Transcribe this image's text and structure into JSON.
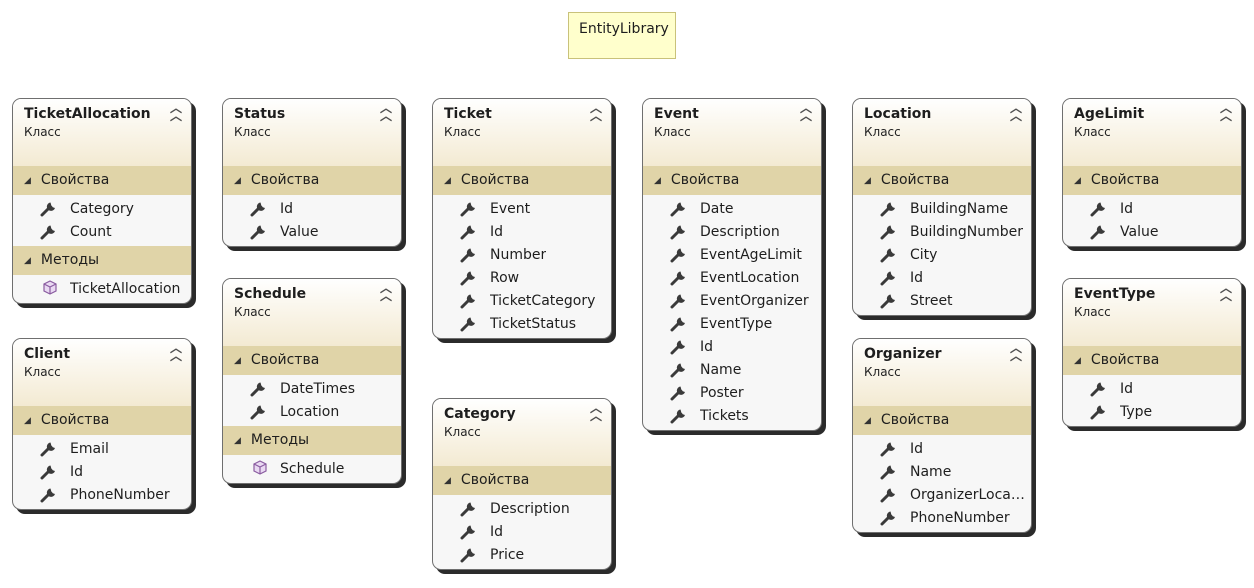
{
  "note": {
    "text": "EntityLibrary"
  },
  "kind_label": "Класс",
  "props_label": "Свойства",
  "methods_label": "Методы",
  "classes": {
    "ticketallocation": {
      "name": "TicketAllocation",
      "properties": [
        "Category",
        "Count"
      ],
      "methods": [
        "TicketAllocation"
      ]
    },
    "client": {
      "name": "Client",
      "properties": [
        "Email",
        "Id",
        "PhoneNumber"
      ]
    },
    "status": {
      "name": "Status",
      "properties": [
        "Id",
        "Value"
      ]
    },
    "schedule": {
      "name": "Schedule",
      "properties": [
        "DateTimes",
        "Location"
      ],
      "methods": [
        "Schedule"
      ]
    },
    "ticket": {
      "name": "Ticket",
      "properties": [
        "Event",
        "Id",
        "Number",
        "Row",
        "TicketCategory",
        "TicketStatus"
      ]
    },
    "category": {
      "name": "Category",
      "properties": [
        "Description",
        "Id",
        "Price"
      ]
    },
    "event": {
      "name": "Event",
      "properties": [
        "Date",
        "Description",
        "EventAgeLimit",
        "EventLocation",
        "EventOrganizer",
        "EventType",
        "Id",
        "Name",
        "Poster",
        "Tickets"
      ]
    },
    "location": {
      "name": "Location",
      "properties": [
        "BuildingName",
        "BuildingNumber",
        "City",
        "Id",
        "Street"
      ]
    },
    "organizer": {
      "name": "Organizer",
      "properties": [
        "Id",
        "Name",
        "OrganizerLocati…",
        "PhoneNumber"
      ]
    },
    "agelimit": {
      "name": "AgeLimit",
      "properties": [
        "Id",
        "Value"
      ]
    },
    "eventtype": {
      "name": "EventType",
      "properties": [
        "Id",
        "Type"
      ]
    }
  }
}
